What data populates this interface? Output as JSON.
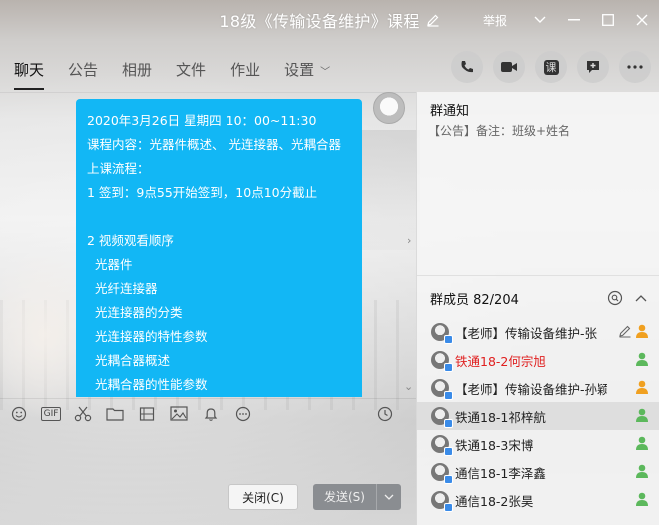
{
  "window": {
    "title": "18级《传输设备维护》课程",
    "report_label": "举报"
  },
  "tabs": [
    {
      "label": "聊天",
      "active": true
    },
    {
      "label": "公告"
    },
    {
      "label": "相册"
    },
    {
      "label": "文件"
    },
    {
      "label": "作业"
    },
    {
      "label": "设置"
    }
  ],
  "top_icons": [
    "phone-icon",
    "video-icon",
    "class-icon",
    "app-add-icon",
    "more-icon"
  ],
  "top_icon_class_label": "课",
  "message": {
    "lines": [
      "2020年3月26日  星期四  10：00~11:30",
      "课程内容：光器件概述、 光连接器、光耦合器",
      "上课流程：",
      "1 签到：9点55开始签到，10点10分截止",
      "",
      "2 视频观看顺序",
      "  光器件",
      "  光纤连接器",
      "  光连接器的分类",
      "  光连接器的特性参数",
      "  光耦合器概述",
      "  光耦合器的性能参数"
    ]
  },
  "toolbar": {
    "gif_label": "GIF",
    "icons": [
      "emoji-icon",
      "gif-icon",
      "scissors-icon",
      "folder-icon",
      "image-file-icon",
      "image-icon",
      "bell-icon",
      "more-tools-icon",
      "history-icon"
    ]
  },
  "buttons": {
    "close_label": "关闭(C)",
    "send_label": "发送(S)"
  },
  "notice": {
    "title": "群通知",
    "text": "【公告】备注：班级+姓名"
  },
  "members": {
    "title": "群成员 82/204",
    "list": [
      {
        "name": "【老师】传输设备维护-张",
        "red": false,
        "role": "admin"
      },
      {
        "name": "铁通18-2何宗旭",
        "red": true,
        "role": "member"
      },
      {
        "name": "【老师】传输设备维护-孙颖",
        "red": false,
        "role": "admin"
      },
      {
        "name": "铁通18-1祁梓航",
        "red": false,
        "role": "member",
        "selected": true
      },
      {
        "name": "铁通18-3宋博",
        "red": false,
        "role": "member"
      },
      {
        "name": "通信18-1李泽鑫",
        "red": false,
        "role": "member"
      },
      {
        "name": "通信18-2张昊",
        "red": false,
        "role": "member"
      }
    ]
  },
  "colors": {
    "bubble": "#12b7f5",
    "red_name": "#e02020",
    "admin_icon": "#f0a020",
    "member_icon": "#5cb85c"
  }
}
